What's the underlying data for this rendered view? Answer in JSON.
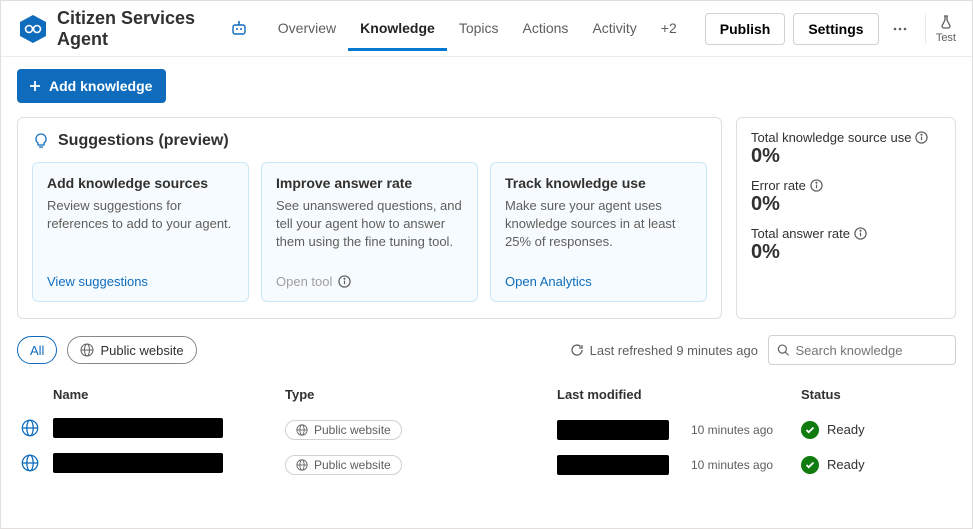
{
  "header": {
    "title": "Citizen Services Agent",
    "tabs": [
      "Overview",
      "Knowledge",
      "Topics",
      "Actions",
      "Activity",
      "+2"
    ],
    "activeTab": "Knowledge",
    "publish": "Publish",
    "settings": "Settings",
    "test": "Test"
  },
  "addKnowledge": "Add knowledge",
  "suggestions": {
    "heading": "Suggestions (preview)",
    "cards": [
      {
        "title": "Add knowledge sources",
        "body": "Review suggestions for references to add to your agent.",
        "link": "View suggestions",
        "disabled": false
      },
      {
        "title": "Improve answer rate",
        "body": "See unanswered questions, and tell your agent how to answer them using the fine tuning tool.",
        "link": "Open tool",
        "disabled": true
      },
      {
        "title": "Track knowledge use",
        "body": "Make sure your agent uses knowledge sources in at least 25% of responses.",
        "link": "Open Analytics",
        "disabled": false
      }
    ]
  },
  "metrics": [
    {
      "label": "Total knowledge source use",
      "value": "0%"
    },
    {
      "label": "Error rate",
      "value": "0%"
    },
    {
      "label": "Total answer rate",
      "value": "0%"
    }
  ],
  "filters": {
    "all": "All",
    "publicWebsite": "Public website",
    "lastRefreshed": "Last refreshed 9 minutes ago",
    "searchPlaceholder": "Search knowledge"
  },
  "table": {
    "columns": {
      "name": "Name",
      "type": "Type",
      "modified": "Last modified",
      "status": "Status"
    },
    "rows": [
      {
        "type": "Public website",
        "ago": "10 minutes ago",
        "status": "Ready"
      },
      {
        "type": "Public website",
        "ago": "10 minutes ago",
        "status": "Ready"
      }
    ]
  }
}
